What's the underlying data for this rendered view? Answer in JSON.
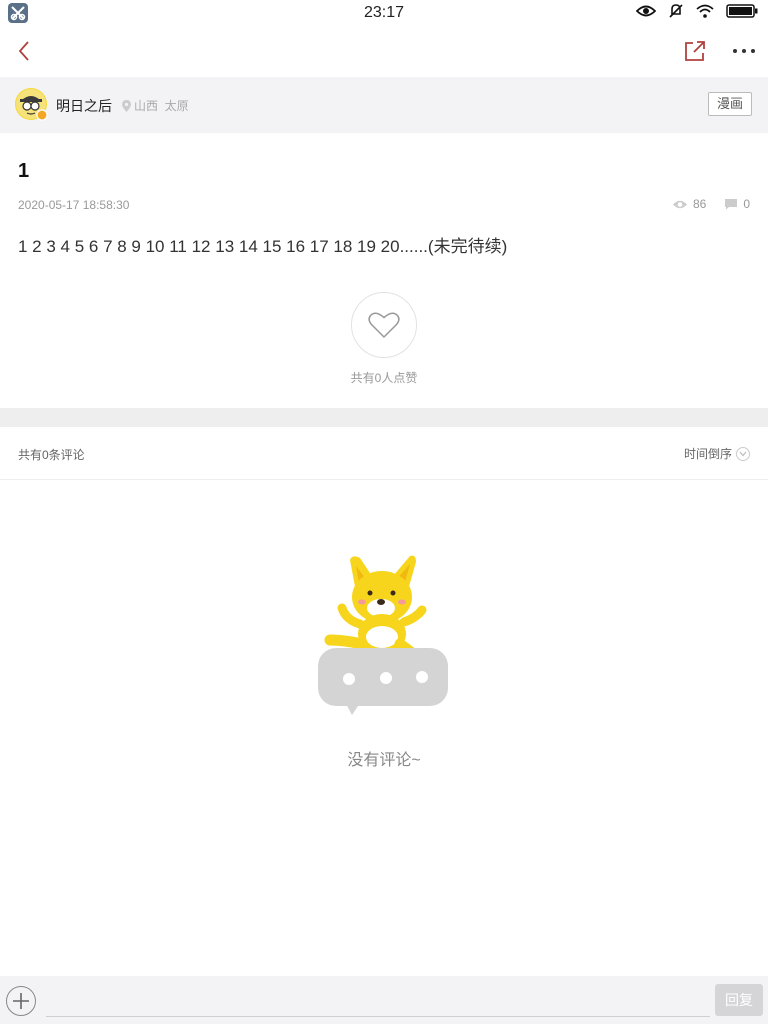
{
  "status_bar": {
    "time": "23:17",
    "icons": [
      "eye-icon",
      "mute-icon",
      "wifi-icon",
      "battery-icon"
    ]
  },
  "nav": {
    "back_icon": "back-chevron-icon",
    "share_icon": "share-icon",
    "more_icon": "more-icon"
  },
  "author": {
    "name": "明日之后",
    "location": "山西  太原",
    "tag": "漫画"
  },
  "post": {
    "title": "1",
    "date": "2020-05-17 18:58:30",
    "views": "86",
    "comments": "0",
    "body": "1 2 3 4 5 6 7 8 9 10 11 12 13 14 15 16 17 18 19 20......(未完待续)",
    "likes_text": "共有0人点赞"
  },
  "comments_section": {
    "count_text": "共有0条评论",
    "sort_label": "时间倒序",
    "empty_text": "没有评论~"
  },
  "bottom_bar": {
    "reply_placeholder": "",
    "reply_label": "回复"
  },
  "colors": {
    "accent": "#c0392b",
    "mascot_yellow": "#f7d51d",
    "bubble_gray": "#d4d4d4",
    "page_bg": "#ffffff",
    "bar_bg": "#f3f3f5"
  }
}
